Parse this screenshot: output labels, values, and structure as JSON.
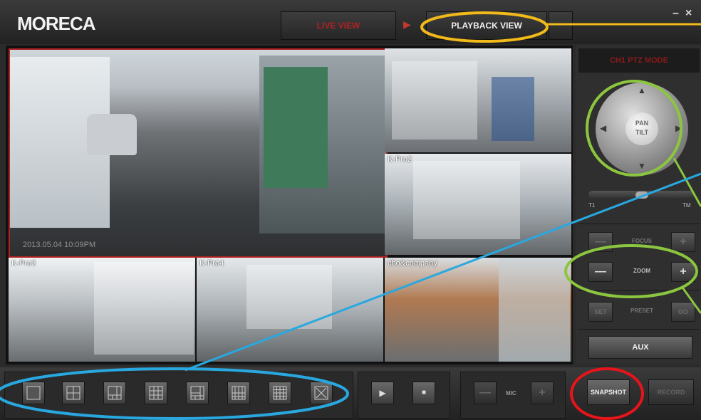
{
  "app": {
    "logo": "MORECA",
    "minimize": "–",
    "close": "×"
  },
  "tabs": {
    "live": "LIVE VIEW",
    "playback": "PLAYBACK VIEW"
  },
  "cameras": [
    {
      "label": "",
      "timestamp": "2013.05.04  10:09PM"
    },
    {
      "label": ""
    },
    {
      "label": "K-Pro2"
    },
    {
      "label": "K-Pro3"
    },
    {
      "label": "K-Pro4"
    },
    {
      "label": "cho&company"
    }
  ],
  "ptz": {
    "status": "CH1  PTZ  MODE",
    "center": [
      "PAN",
      "TILT"
    ],
    "zoom_min": "T1",
    "zoom_max": "TM",
    "focus": "FOCUS",
    "zoom": "ZOOM",
    "preset": "PRESET",
    "set": "SET",
    "go": "GO",
    "aux": "AUX",
    "minus": "—",
    "plus": "+"
  },
  "toolbar": {
    "mic": "MIC",
    "snapshot": "SNAPSHOT",
    "record": "RECORD",
    "play": "▶",
    "stop": "■",
    "minus": "—",
    "plus": "+"
  },
  "colors": {
    "annotation_orange": "#f2b91a",
    "annotation_green": "#8cc63f",
    "annotation_blue": "#29a8e0",
    "annotation_red": "#e8141b",
    "active_border": "#b22222"
  }
}
